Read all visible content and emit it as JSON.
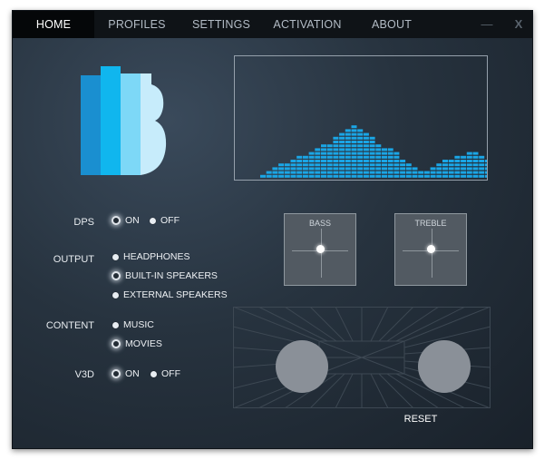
{
  "nav": {
    "tabs": [
      {
        "label": "HOME",
        "active": true
      },
      {
        "label": "PROFILES",
        "active": false
      },
      {
        "label": "SETTINGS",
        "active": false
      },
      {
        "label": "ACTIVATION",
        "active": false
      },
      {
        "label": "ABOUT",
        "active": false
      }
    ],
    "minimize_label": "—",
    "close_label": "X"
  },
  "logo": {
    "icon": "bars-b-logo",
    "colors": [
      "#1a8fd0",
      "#10b6ee",
      "#7dd8f7",
      "#c7ecfb"
    ]
  },
  "visualizer": {
    "color": "#1aa6e6",
    "levels": [
      1,
      2,
      3,
      4,
      4,
      5,
      6,
      6,
      7,
      8,
      9,
      9,
      11,
      12,
      13,
      14,
      13,
      12,
      11,
      9,
      8,
      8,
      7,
      5,
      4,
      3,
      2,
      2,
      3,
      4,
      5,
      5,
      6,
      6,
      7,
      7,
      6,
      5,
      5,
      4,
      3
    ]
  },
  "dps": {
    "label": "DPS",
    "options": [
      {
        "label": "ON",
        "selected": true
      },
      {
        "label": "OFF",
        "selected": false
      }
    ]
  },
  "output": {
    "label": "OUTPUT",
    "options": [
      {
        "label": "HEADPHONES",
        "selected": false
      },
      {
        "label": "BUILT-IN SPEAKERS",
        "selected": true
      },
      {
        "label": "EXTERNAL SPEAKERS",
        "selected": false
      }
    ]
  },
  "content": {
    "label": "CONTENT",
    "options": [
      {
        "label": "MUSIC",
        "selected": false
      },
      {
        "label": "MOVIES",
        "selected": true
      }
    ]
  },
  "v3d": {
    "label": "V3D",
    "options": [
      {
        "label": "ON",
        "selected": true
      },
      {
        "label": "OFF",
        "selected": false
      }
    ]
  },
  "bass": {
    "label": "BASS"
  },
  "treble": {
    "label": "TREBLE"
  },
  "reset_label": "RESET"
}
